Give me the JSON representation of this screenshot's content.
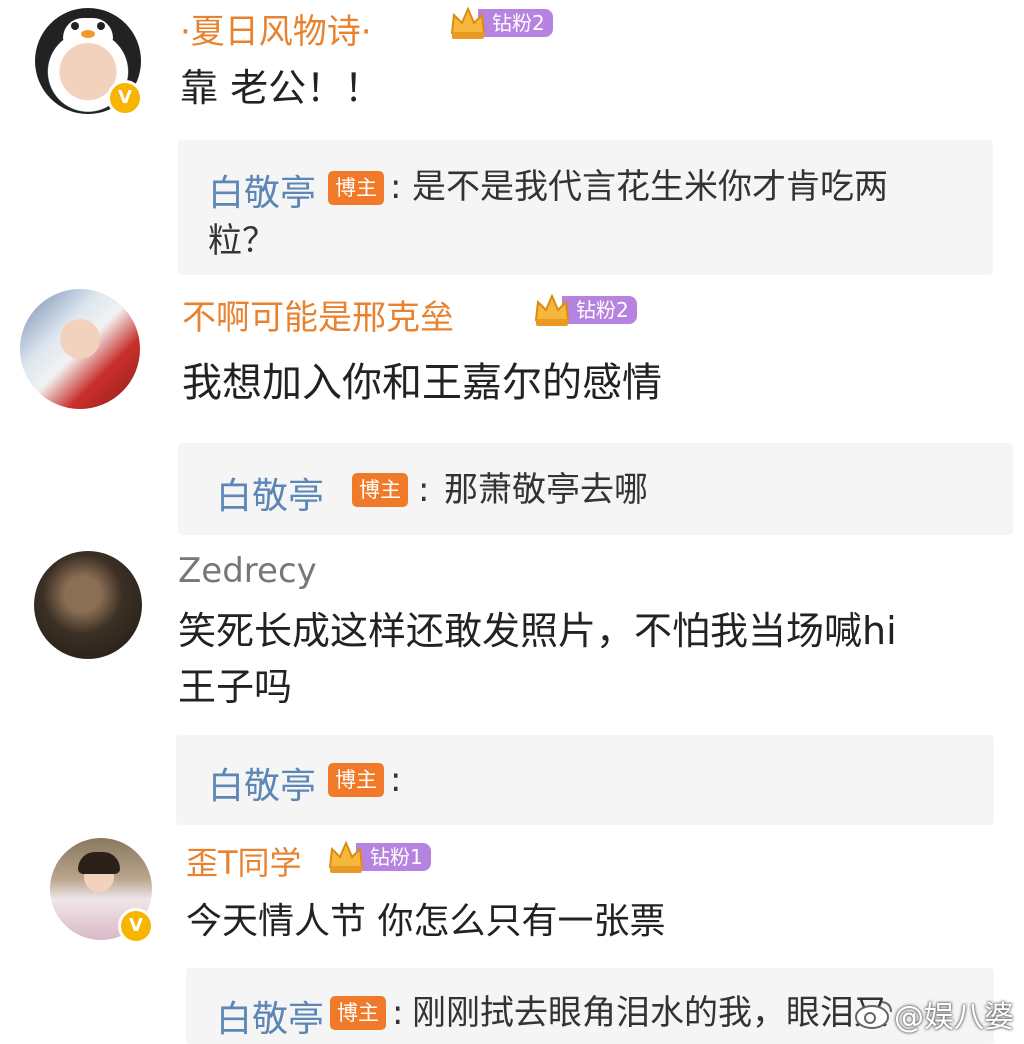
{
  "comments": [
    {
      "user": "·夏日风物诗·",
      "fan_badge": "钻粉2",
      "verified": "V",
      "text": "靠 老公！！",
      "reply": {
        "user": "白敬亭",
        "tag": "博主",
        "sep": ":",
        "text": "是不是我代言花生米你才肯吃两",
        "text2": "粒？"
      }
    },
    {
      "user": "不啊可能是邢克垒",
      "fan_badge": "钻粉2",
      "text": "我想加入你和王嘉尔的感情",
      "reply": {
        "user": "白敬亭",
        "tag": "博主",
        "sep": ":",
        "text": "那萧敬亭去哪"
      }
    },
    {
      "user": "Zedrecy",
      "text": "笑死长成这样还敢发照片，不怕我当场喊hi",
      "text2": "王子吗",
      "reply": {
        "user": "白敬亭",
        "tag": "博主",
        "sep": ":",
        "text": ""
      }
    },
    {
      "user": "歪T同学",
      "fan_badge": "钻粉1",
      "verified": "V",
      "text": "今天情人节 你怎么只有一张票",
      "reply": {
        "user": "白敬亭",
        "tag": "博主",
        "sep": ":",
        "text": "刚刚拭去眼角泪水的我，眼泪又"
      }
    }
  ],
  "watermark": "@娱八婆",
  "colors": {
    "username": "#e8822f",
    "reply_user": "#5b86b6",
    "bozhu_tag": "#f07a2a",
    "fan_pill": "#b684e0",
    "verified": "#f7b500"
  }
}
